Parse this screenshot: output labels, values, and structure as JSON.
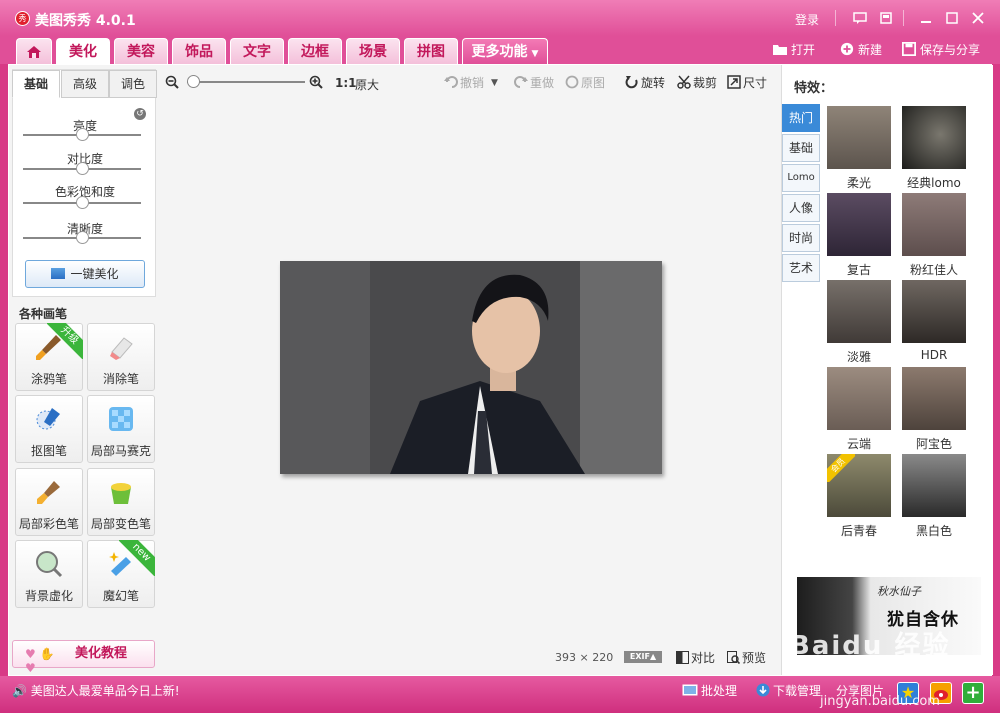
{
  "app": {
    "title": "美图秀秀 4.0.1",
    "logo_glyph": "秀"
  },
  "titlebar": {
    "login": "登录"
  },
  "tabs": [
    {
      "label": "美化",
      "active": true
    },
    {
      "label": "美容"
    },
    {
      "label": "饰品"
    },
    {
      "label": "文字"
    },
    {
      "label": "边框"
    },
    {
      "label": "场景"
    },
    {
      "label": "拼图"
    },
    {
      "label": "更多功能"
    }
  ],
  "top_actions": {
    "open": "打开",
    "new": "新建",
    "save": "保存与分享"
  },
  "adjust": {
    "tabs": [
      "基础",
      "高级",
      "调色"
    ],
    "sliders": [
      {
        "label": "亮度",
        "level": 0.5
      },
      {
        "label": "对比度",
        "level": 0.5
      },
      {
        "label": "色彩饱和度",
        "level": 0.5
      },
      {
        "label": "清晰度",
        "level": 0.5
      }
    ],
    "auto_button": "一键美化"
  },
  "brushes": {
    "title": "各种画笔",
    "items": [
      {
        "label": "涂鸦笔",
        "badge": "升级"
      },
      {
        "label": "消除笔"
      },
      {
        "label": "抠图笔"
      },
      {
        "label": "局部马赛克"
      },
      {
        "label": "局部彩色笔"
      },
      {
        "label": "局部变色笔"
      },
      {
        "label": "背景虚化"
      },
      {
        "label": "魔幻笔",
        "badge": "new"
      }
    ]
  },
  "tutorial": {
    "label": "美化教程"
  },
  "toolbar": {
    "zoom_one": "1:1",
    "zoom_original": "原大",
    "undo": "撤销",
    "redo": "重做",
    "original": "原图",
    "rotate": "旋转",
    "crop": "裁剪",
    "resize": "尺寸"
  },
  "canvas": {
    "dimensions": "393 × 220",
    "exif": "EXIF▲",
    "compare": "对比",
    "preview": "预览"
  },
  "effects": {
    "title": "特效：",
    "categories": [
      "热门",
      "基础",
      "Lomo",
      "人像",
      "时尚",
      "艺术"
    ],
    "items": [
      {
        "label": "柔光"
      },
      {
        "label": "经典lomo"
      },
      {
        "label": "复古"
      },
      {
        "label": "粉红佳人"
      },
      {
        "label": "淡雅"
      },
      {
        "label": "HDR"
      },
      {
        "label": "云端"
      },
      {
        "label": "阿宝色"
      },
      {
        "label": "后青春",
        "badge": "会员"
      },
      {
        "label": "黑白色"
      }
    ],
    "ad": {
      "logo": "秋水仙子",
      "text": "犹自含休"
    }
  },
  "status": {
    "news": "美图达人最爱单品今日上新!",
    "batch": "批处理",
    "download": "下载管理",
    "share": "分享图片"
  },
  "watermark": {
    "main": "Baidu 经验",
    "url": "jingyan.baidu.com"
  },
  "colors": {
    "brand": "#e04f98",
    "accent_blue": "#3a8ad8"
  }
}
